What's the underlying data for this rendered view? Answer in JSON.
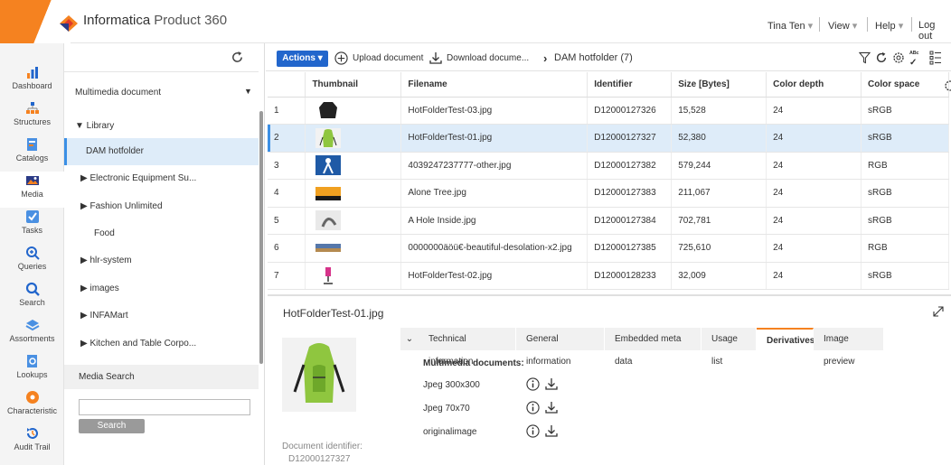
{
  "header": {
    "brand": "Informatica",
    "product": "Product 360",
    "user": "Tina Ten",
    "view": "View",
    "help": "Help",
    "logout": "Log out"
  },
  "colors": {
    "accent": "#f58220",
    "primary": "#2266cc",
    "selection": "#deecf9"
  },
  "nav": [
    {
      "label": "Dashboard",
      "icon": "bar-chart-icon"
    },
    {
      "label": "Structures",
      "icon": "hierarchy-icon"
    },
    {
      "label": "Catalogs",
      "icon": "catalog-icon"
    },
    {
      "label": "Media",
      "icon": "media-icon",
      "active": true
    },
    {
      "label": "Tasks",
      "icon": "checkbox-icon"
    },
    {
      "label": "Queries",
      "icon": "query-icon"
    },
    {
      "label": "Search",
      "icon": "search-icon"
    },
    {
      "label": "Assortments",
      "icon": "layers-icon"
    },
    {
      "label": "Lookups",
      "icon": "lookup-icon"
    },
    {
      "label": "Characteristic",
      "icon": "characteristic-icon"
    },
    {
      "label": "Audit Trail",
      "icon": "audit-icon"
    }
  ],
  "tree": {
    "dropdown": "Multimedia document",
    "root": "▼ Library",
    "items": [
      {
        "label": "DAM hotfolder",
        "selected": true
      },
      {
        "label": "▶ Electronic Equipment Su..."
      },
      {
        "label": "▶ Fashion Unlimited"
      },
      {
        "label": "Food"
      },
      {
        "label": "▶ hlr-system"
      },
      {
        "label": "▶ images"
      },
      {
        "label": "▶ INFAMart"
      },
      {
        "label": "▶ Kitchen and Table Corpo..."
      }
    ],
    "media_search_title": "Media Search",
    "search_placeholder": "",
    "search_button": "Search"
  },
  "toolbar": {
    "actions": "Actions",
    "upload": "Upload document",
    "download": "Download docume...",
    "breadcrumb": "DAM hotfolder (7)"
  },
  "table": {
    "columns": [
      "",
      "Thumbnail",
      "Filename",
      "Identifier",
      "Size [Bytes]",
      "Color depth",
      "Color space"
    ],
    "rows": [
      {
        "n": "1",
        "file": "HotFolderTest-03.jpg",
        "id": "D12000127326",
        "size": "15,528",
        "depth": "24",
        "space": "sRGB",
        "thumb": "black-jacket"
      },
      {
        "n": "2",
        "file": "HotFolderTest-01.jpg",
        "id": "D12000127327",
        "size": "52,380",
        "depth": "24",
        "space": "sRGB",
        "thumb": "green-backpack",
        "selected": true
      },
      {
        "n": "3",
        "file": "4039247237777-other.jpg",
        "id": "D12000127382",
        "size": "579,244",
        "depth": "24",
        "space": "RGB",
        "thumb": "blue-figure"
      },
      {
        "n": "4",
        "file": "Alone Tree.jpg",
        "id": "D12000127383",
        "size": "211,067",
        "depth": "24",
        "space": "sRGB",
        "thumb": "sunset"
      },
      {
        "n": "5",
        "file": "A Hole Inside.jpg",
        "id": "D12000127384",
        "size": "702,781",
        "depth": "24",
        "space": "sRGB",
        "thumb": "grey-sculpture"
      },
      {
        "n": "6",
        "file": "0000000äöü€-beautiful-desolation-x2.jpg",
        "id": "D12000127385",
        "size": "725,610",
        "depth": "24",
        "space": "RGB",
        "thumb": "landscape"
      },
      {
        "n": "7",
        "file": "HotFolderTest-02.jpg",
        "id": "D12000128233",
        "size": "32,009",
        "depth": "24",
        "space": "sRGB",
        "thumb": "pink-chair"
      }
    ]
  },
  "detail": {
    "title": "HotFolderTest-01.jpg",
    "doc_id_label": "Document identifier:",
    "doc_id": "D12000127327",
    "tabs": [
      "Technical information",
      "General information",
      "Embedded meta data",
      "Usage list",
      "Derivatives",
      "Image preview"
    ],
    "active_tab": "Derivatives",
    "derivatives_heading": "Multimedia documents:",
    "derivatives": [
      "Jpeg 300x300",
      "Jpeg 70x70",
      "originalimage"
    ]
  }
}
